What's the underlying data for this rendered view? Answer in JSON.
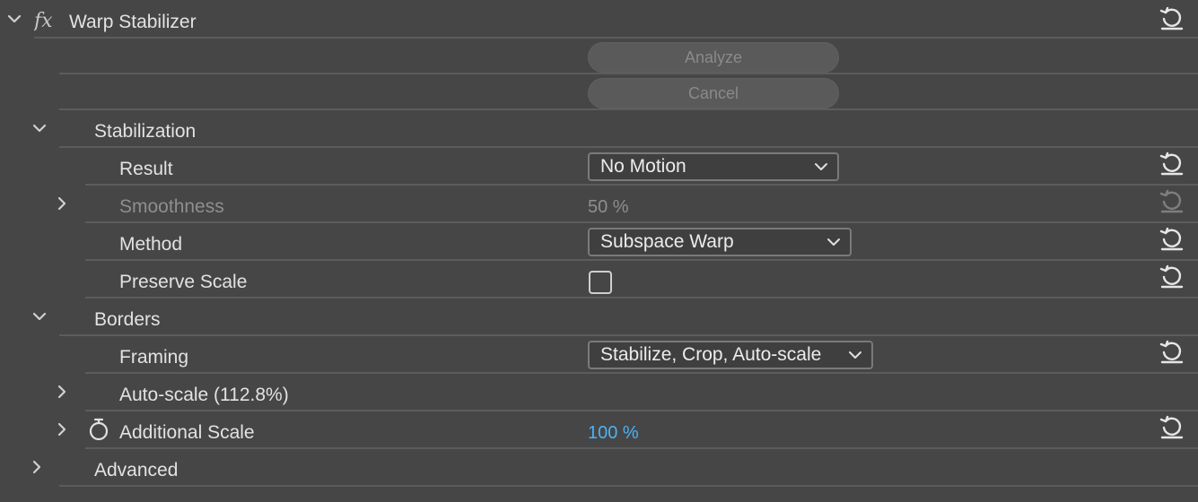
{
  "effect": {
    "title": "Warp Stabilizer",
    "fx_label": "fx"
  },
  "buttons": {
    "analyze": "Analyze",
    "cancel": "Cancel"
  },
  "sections": {
    "stabilization": "Stabilization",
    "borders": "Borders",
    "advanced": "Advanced"
  },
  "params": {
    "result": {
      "label": "Result",
      "value": "No Motion"
    },
    "smoothness": {
      "label": "Smoothness",
      "value": "50 %"
    },
    "method": {
      "label": "Method",
      "value": "Subspace Warp"
    },
    "preserve_scale": {
      "label": "Preserve Scale",
      "checked": false
    },
    "framing": {
      "label": "Framing",
      "value": "Stabilize, Crop, Auto-scale"
    },
    "auto_scale": {
      "label": "Auto-scale (112.8%)"
    },
    "additional_scale": {
      "label": "Additional Scale",
      "value": "100 %"
    }
  },
  "icons": {
    "collapse": "chevron-down-icon",
    "expand": "chevron-right-icon",
    "reset": "reset-icon",
    "stopwatch": "stopwatch-icon",
    "fx": "fx-icon"
  },
  "colors": {
    "background": "#464646",
    "value_blue": "#4ab3f5",
    "divider": "#5c5c5c"
  }
}
